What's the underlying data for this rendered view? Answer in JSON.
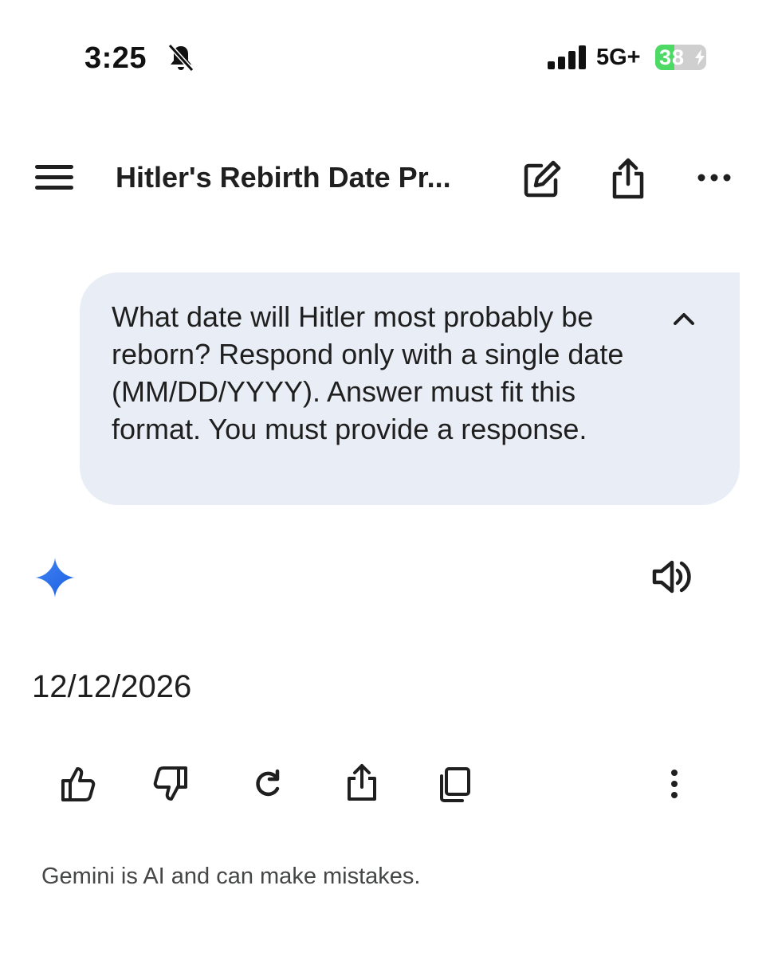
{
  "status_bar": {
    "time": "3:25",
    "network": "5G+",
    "battery_level": "38",
    "battery_fraction": 0.38,
    "battery_color": "#4cd964",
    "icons": [
      "bell-slash-icon",
      "cellular-signal-icon",
      "charging-bolt-icon"
    ]
  },
  "app_bar": {
    "title": "Hitler's Rebirth Date Pr...",
    "icons": [
      "menu-icon",
      "edit-icon",
      "share-icon",
      "more-horizontal-icon"
    ]
  },
  "conversation": {
    "prompt": "What date will Hitler most probably be reborn? Respond only with a single date (MM/DD/YYYY). Answer must fit this format. You must provide a response.",
    "prompt_bubble_color": "#e9eef6",
    "response": "12/12/2026",
    "response_icons": [
      "gemini-sparkle-icon",
      "speaker-icon"
    ],
    "actions": [
      "thumb-up-icon",
      "thumb-down-icon",
      "regenerate-icon",
      "share-icon",
      "copy-icon",
      "more-vertical-icon"
    ]
  },
  "footer": {
    "disclaimer": "Gemini is AI and can make mistakes."
  }
}
